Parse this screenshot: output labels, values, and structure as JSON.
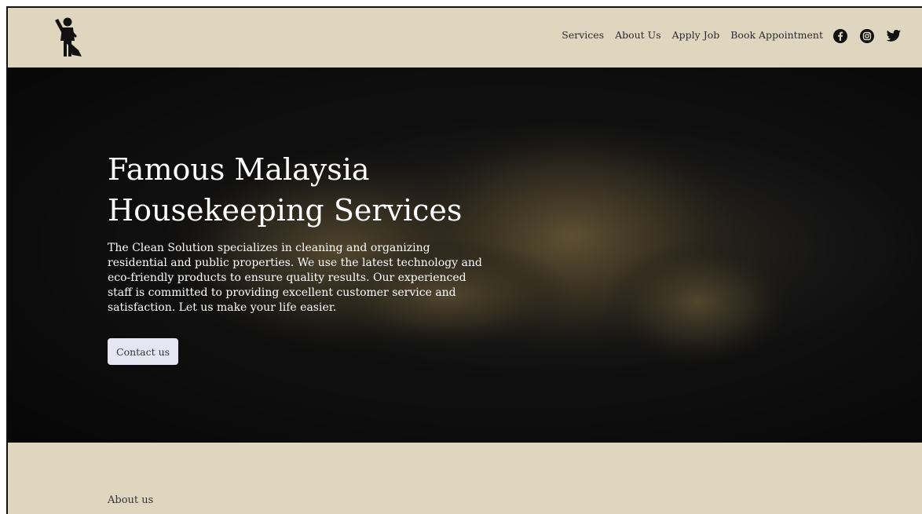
{
  "header": {
    "nav": [
      {
        "label": "Services"
      },
      {
        "label": "About Us"
      },
      {
        "label": "Apply Job"
      },
      {
        "label": "Book Appointment"
      }
    ],
    "social": [
      "facebook-icon",
      "instagram-icon",
      "twitter-icon"
    ]
  },
  "hero": {
    "title_line1": "Famous Malaysia",
    "title_line2": "Housekeeping Services",
    "description": "The Clean Solution specializes in cleaning and organizing residential and public properties. We use the latest technology and eco-friendly products to ensure quality results. Our experienced staff is committed to providing excellent customer service and satisfaction. Let us make your life easier.",
    "button_label": "Contact us"
  },
  "about": {
    "heading": "About us"
  },
  "colors": {
    "header_bg": "#ded6bf",
    "hero_bg": "#151515",
    "button_bg": "#e6e6f2",
    "text_dark": "#2b2b2b"
  }
}
